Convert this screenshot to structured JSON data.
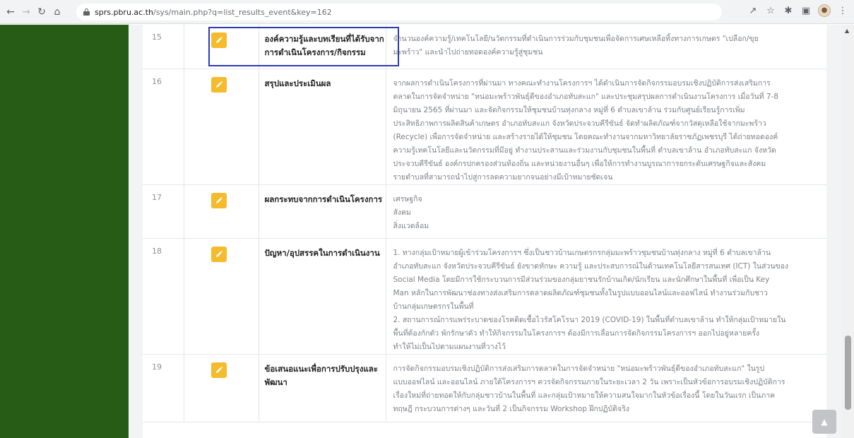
{
  "browser": {
    "url_host": "sprs.pbru.ac.th",
    "url_path": "/sys/main.php?q=list_results_event&key=162",
    "icons": [
      "back-icon",
      "forward-icon",
      "reload-icon",
      "home-icon",
      "lock-icon",
      "share-icon",
      "star-icon",
      "extensions-icon",
      "sidebar-icon",
      "profile-avatar",
      "menu-icon"
    ]
  },
  "colors": {
    "sidebar": "#275c17",
    "edit_button": "#f5bb2c",
    "highlight_border": "#2b3ab4"
  },
  "rows": [
    {
      "num": "15",
      "label_lines": [
        "องค์ความรู้และบทเรียนที่ได้รับจาก",
        "การดำเนินโครงการ/กิจกรรม"
      ],
      "value_lines": [
        "จำนวนองค์ความรู้/เทคโนโลยี/นวัตกรรมที่ดำเนินการร่วมกับชุมชนเพื่อจัดการเศษเหลือทิ้งทางการเกษตร \"เปลือก/ขุย",
        "มะพร้าว\" และนำไปถ่ายทอดองค์ความรู้สู่ชุมชน"
      ]
    },
    {
      "num": "16",
      "label_lines": [
        "สรุปและประเมินผล"
      ],
      "value_lines": [
        "จากผลการดำเนินโครงการที่ผ่านมา ทางคณะทำงานโครงการฯ ได้ดำเนินการจัดกิจกรรมอบรมเชิงปฏิบัติการส่งเสริมการ",
        "ตลาดในการจัดจำหน่าย \"หน่อมะพร้าวพันธุ์ดีของอำเภอทับสะแก\" และประชุมสรุปผลการดำเนินงานโครงการ เมื่อวันที่ 7-8",
        "มิถุนายน 2565 ที่ผ่านมา และจัดกิจกรรมให้ชุมชนบ้านทุ่งกลาง หมู่ที่ 6 ตำบลเขาล้าน ร่วมกับศูนย์เรียนรู้การเพิ่ม",
        "ประสิทธิภาพการผลิตสินค้าเกษตร อำเภอทับสะแก จังหวัดประจวบคีรีขันธ์ จัดทำผลิตภัณฑ์จากวัสดุเหลือใช้จากมะพร้าว",
        "(Recycle) เพื่อการจัดจำหน่าย และสร้างรายได้ให้ชุมชน โดยคณะทำงานจากมหาวิทยาลัยราชภัฏเพชรบุรี ได้ถ่ายทอดองค์",
        "ความรู้เทคโนโลยีและนวัตกรรมที่มีอยู่ ทำงานประสานและร่วมงานกับชุมชนในพื้นที่ ตำบลเขาล้าน อำเภอทับสะแก จังหวัด",
        "ประจวบคีรีขันธ์ องค์กรปกครองส่วนท้องถิ่น และหน่วยงานอื่นๆ เพื่อให้การทำงานบูรณาการยกระดับเศรษฐกิจและสังคม",
        "รายตำบลที่สามารถนำไปสู่การลดความยากจนอย่างมีเป้าหมายชัดเจน"
      ]
    },
    {
      "num": "17",
      "label_lines": [
        "ผลกระทบจากการดำเนินโครงการ"
      ],
      "value_lines": [
        "เศรษฐกิจ",
        "สังคม",
        "สิ่งแวดล้อม"
      ]
    },
    {
      "num": "18",
      "label_lines": [
        "ปัญหา/อุปสรรคในการดำเนินงาน"
      ],
      "value_lines": [
        "1. ทางกลุ่มเป้าหมายผู้เข้าร่วมโครงการฯ ซึ่งเป็นชาวบ้านเกษตรกรกลุ่มมะพร้าวชุมชนบ้านทุ่งกลาง หมู่ที่ 6 ตำบลเขาล้าน",
        "อำเภอทับสะแก จังหวัดประจวบคีรีขันธ์ ยังขาดทักษะ ความรู้ และประสบการณ์ในด้านเทคโนโลยีสารสนเทศ (ICT) ในส่วนของ",
        "Social Media โดยมีการใช้กระบวนการมีส่วนร่วมของกลุ่มยาชนรักบ้านเกิด/นักเรียน และนักศึกษาในพื้นที่ เพื่อเป็น Key",
        "Man หลักในการพัฒนาช่องทางส่งเสริมการตลาดผลิตภัณฑ์ชุมชนทั้งในรูปแบบออนไลน์และออฟไลน์ ทำงานร่วมกับชาว",
        "บ้านกลุ่มเกษตรกรในพื้นที่",
        "2. สถานการณ์การแพร่ระบาดของโรคติดเชื้อไวรัสโคโรนา 2019 (COVID-19) ในพื้นที่ตำบลเขาล้าน ทำให้กลุ่มเป้าหมายใน",
        "พื้นที่ต้องกักตัว พักรักษาตัว ทำให้กิจกรรมในโครงการฯ ต้องมีการเลื่อนการจัดกิจกรรมโครงการฯ ออกไปอยู่หลายครั้ง",
        "ทำให้ไม่เป็นไปตามแผนงานที่วางไว้"
      ]
    },
    {
      "num": "19",
      "label_lines": [
        "ข้อเสนอแนะเพื่อการปรับปรุงและ",
        "พัฒนา"
      ],
      "value_lines": [
        "การจัดกิจกรรมอบรมเชิงปฏิบัติการส่งเสริมการตลาดในการจัดจำหน่าย \"หน่อมะพร้าวพันธุ์ดีของอำเภอทับสะแก\" ในรูป",
        "แบบออฟไลน์ และออนไลน์ ภายใต้โครงการฯ ควรจัดกิจกรรมภายในระยะเวลา 2 วัน เพราะเป็นหัวข้อการอบรมเชิงปฏิบัติการ",
        "เรื่องใหม่ที่ถ่ายทอดให้กับกลุ่มชาวบ้านในพื้นที่ และกลุ่มเป้าหมายให้ความสนใจมากในหัวข้อเรื่องนี้ โดยในวันแรก เป็นภาค",
        "ทฤษฎี กระบวนการต่างๆ และวันที่ 2 เป็นกิจกรรม Workshop ฝึกปฏิบัติจริง"
      ]
    }
  ]
}
